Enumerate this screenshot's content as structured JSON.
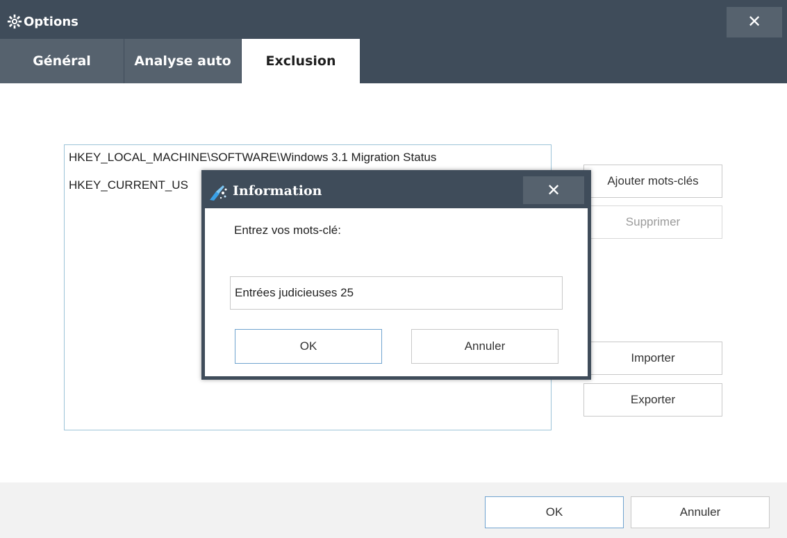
{
  "window": {
    "title": "Options",
    "close_glyph": "✕"
  },
  "tabs": [
    {
      "label": "Général"
    },
    {
      "label": "Analyse auto"
    },
    {
      "label": "Exclusion",
      "active": true
    }
  ],
  "exclusion": {
    "items": [
      "HKEY_LOCAL_MACHINE\\SOFTWARE\\Windows 3.1 Migration Status",
      "HKEY_CURRENT_US"
    ],
    "add_keywords_label": "Ajouter mots-clés",
    "delete_label": "Supprimer",
    "import_label": "Importer",
    "export_label": "Exporter"
  },
  "footer": {
    "ok_label": "OK",
    "cancel_label": "Annuler"
  },
  "dialog": {
    "title": "Information",
    "close_glyph": "✕",
    "prompt": "Entrez vos mots-clé:",
    "input_value": "Entrées judicieuses 25",
    "ok_label": "OK",
    "cancel_label": "Annuler"
  },
  "icons": {
    "window_icon": "gear-icon",
    "dialog_icon": "broom-sparkle-icon"
  },
  "colors": {
    "titlebar": "#3f4c5a",
    "tab_inactive": "#56626e",
    "accent_border": "#6fa3cf"
  }
}
